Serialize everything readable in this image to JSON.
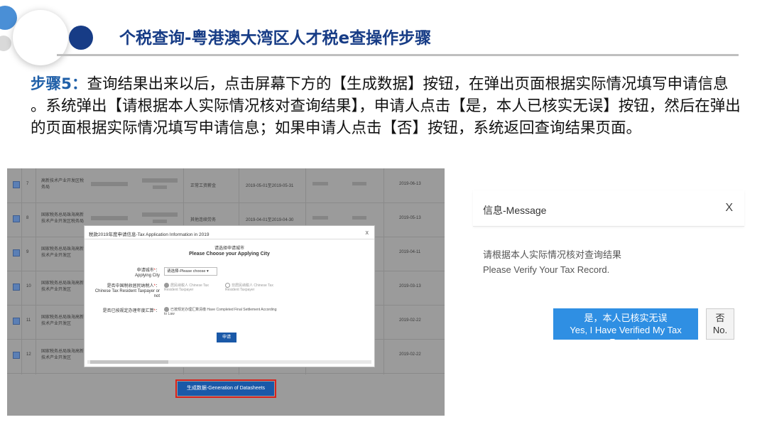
{
  "slide": {
    "title": "个税查询-粤港澳大湾区人才税e查操作步骤",
    "step_label": "步骤5：",
    "step_text": "查询结果出来以后，点击屏幕下方的【生成数据】按钮，在弹出页面根据实际情况填写申请信息 。系统弹出【请根据本人实际情况核对查询结果】，申请人点击【是，本人已核实无误】按钮，然后在弹出的页面根据实际情况填写申请信息；如果申请人点击【否】按钮，系统返回查询结果页面。"
  },
  "records": [
    {
      "num": "7",
      "name": "高新技术产业开发区税务局",
      "type": "正常工资薪金",
      "period": "2019-05-01至2019-05-31",
      "date": "2019-06-13"
    },
    {
      "num": "8",
      "name": "国家税务总局珠海高新技术产业开发区税务局",
      "type": "其他连续劳务",
      "period": "2019-04-01至2019-04-30",
      "date": "2019-05-13"
    },
    {
      "num": "9",
      "name": "国家税务总局珠海高新技术产业开发区",
      "type": "",
      "period": "",
      "date": "2019-04-11"
    },
    {
      "num": "10",
      "name": "国家税务总局珠海高新技术产业开发区",
      "type": "",
      "period": "",
      "date": "2019-03-13"
    },
    {
      "num": "11",
      "name": "国家税务总局珠海高新技术产业开发区",
      "type": "",
      "period": "",
      "date": "2019-02-22"
    },
    {
      "num": "12",
      "name": "国家税务总局珠海高新技术产业开发区",
      "type": "",
      "period": "",
      "date": "2019-02-22"
    }
  ],
  "generate_button": "生成数据-Generation of Datasheets",
  "modal": {
    "title": "税款2019年度申请信息-Tax Application Information in 2019",
    "close": "x",
    "city_zh": "请选择申请城市",
    "city_en": "Please Choose your Applying City",
    "applying_city_label": "申请城市",
    "applying_city_en": "Applying City",
    "applying_city_placeholder": "请选择-Please choose",
    "resident_label": "是否中国税收居民纳税人",
    "resident_en": "Chinese Tax Resident Taxpayer or not",
    "resident_yes": "居民纳税人 Chinese Tax Resident Taxpayer",
    "resident_no": "非居民纳税人 Chinese Tax Resident Taxpayer",
    "settlement_label": "是否已按规定办理年度汇算",
    "settlement_option": "已按规定办理汇算清缴 Have Completed Final Settlement According to Law",
    "apply_button": "申请"
  },
  "message": {
    "title": "信息-Message",
    "close": "X",
    "text_zh": "请根据本人实际情况核对查询结果",
    "text_en": "Please Verify Your Tax Record.",
    "yes_zh": "是，本人已核实无误",
    "yes_en": "Yes, I Have Verified My Tax Record.",
    "no_zh": "否",
    "no_en": "No."
  }
}
